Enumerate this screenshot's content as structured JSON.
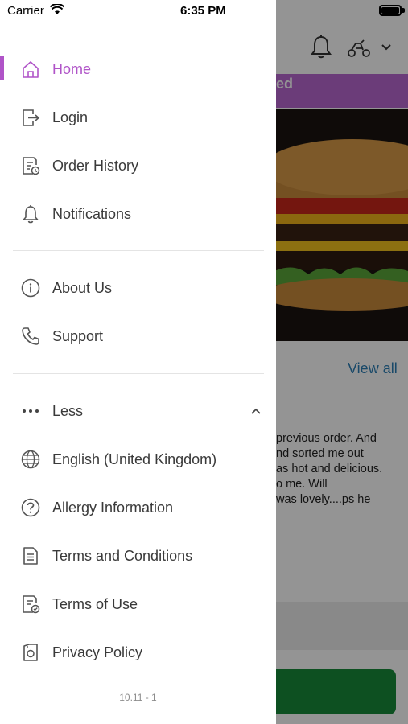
{
  "status_bar": {
    "carrier": "Carrier",
    "time": "6:35 PM"
  },
  "background": {
    "banner_text": "ed",
    "view_all": "View all",
    "review_lines": [
      "previous order. And",
      "nd sorted me out",
      "as hot and delicious.",
      "o me. Will",
      "was lovely....ps he"
    ]
  },
  "menu": {
    "items": [
      {
        "label": "Home",
        "icon": "home-icon",
        "active": true
      },
      {
        "label": "Login",
        "icon": "login-icon"
      },
      {
        "label": "Order History",
        "icon": "order-history-icon"
      },
      {
        "label": "Notifications",
        "icon": "bell-icon"
      },
      {
        "label": "About Us",
        "icon": "info-icon"
      },
      {
        "label": "Support",
        "icon": "phone-icon"
      },
      {
        "label": "Less",
        "icon": "more-dots-icon"
      },
      {
        "label": "English (United Kingdom)",
        "icon": "globe-icon"
      },
      {
        "label": "Allergy Information",
        "icon": "question-icon"
      },
      {
        "label": "Terms and Conditions",
        "icon": "document-icon"
      },
      {
        "label": "Terms of Use",
        "icon": "document-check-icon"
      },
      {
        "label": "Privacy Policy",
        "icon": "privacy-icon"
      }
    ]
  },
  "version": "10.11 - 1",
  "colors": {
    "accent": "#b054c8",
    "link": "#2c7fb5",
    "cta": "#178a3a",
    "banner": "#b868d0"
  }
}
